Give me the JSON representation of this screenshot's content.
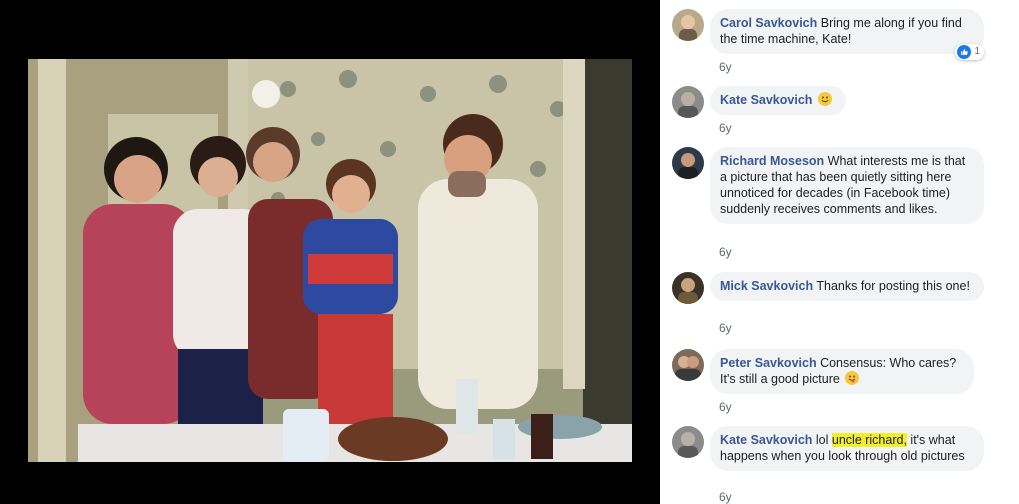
{
  "photo": {
    "alt": ""
  },
  "comments": [
    {
      "name": "Carol Savkovich",
      "text": "Bring me along if you find the time machine, Kate!",
      "time": "6y",
      "reactions": "1"
    },
    {
      "name": "Kate Savkovich",
      "text": "",
      "time": "6y"
    },
    {
      "name": "Richard Moseson",
      "text": "What interests me is that a picture that has been quietly sitting here unnoticed for decades (in Facebook time) suddenly receives comments and likes.",
      "time": "6y"
    },
    {
      "name": "Mick Savkovich",
      "text": "Thanks for posting this one!",
      "time": "6y"
    },
    {
      "name": "Peter Savkovich",
      "text": "Consensus: Who cares? It's still a good picture",
      "time": "6y"
    },
    {
      "name": "Kate Savkovich",
      "text_pre": "lol ",
      "text_highlight": "uncle richard,",
      "text_post": " it's what happens when you look through old pictures",
      "time": "6y"
    }
  ],
  "colors": {
    "name": "#385898",
    "bubble": "#f2f3f5",
    "like": "#1877f2",
    "highlight": "#f4ef2b"
  }
}
